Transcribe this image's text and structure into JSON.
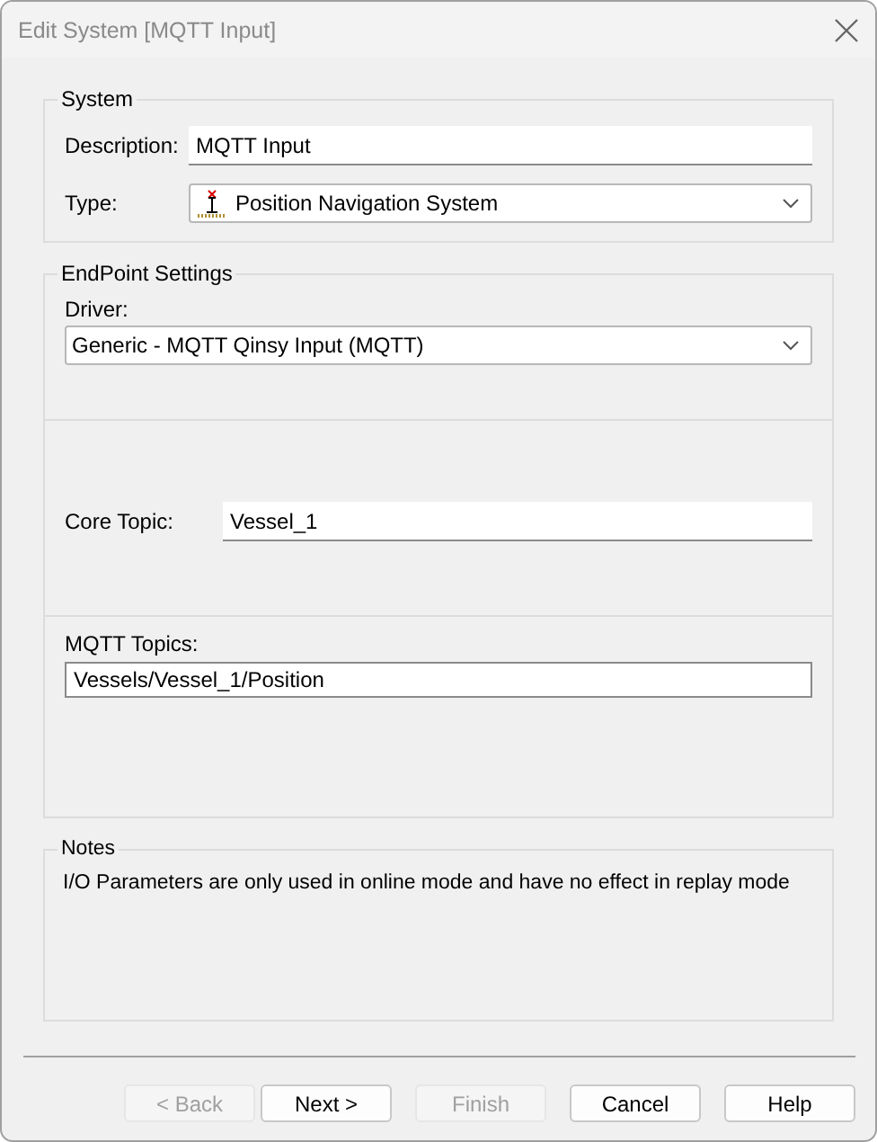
{
  "window": {
    "title": "Edit System [MQTT Input]"
  },
  "system": {
    "title": "System",
    "description": {
      "label": "Description:",
      "value": "MQTT Input"
    },
    "type": {
      "label": "Type:",
      "value": "Position Navigation System"
    }
  },
  "endpoint": {
    "title": "EndPoint Settings",
    "driver": {
      "label": "Driver:",
      "value": "Generic - MQTT Qinsy Input (MQTT)"
    },
    "core_topic": {
      "label": "Core Topic:",
      "value": "Vessel_1"
    },
    "mqtt_topics": {
      "label": "MQTT Topics:",
      "value": "Vessels/Vessel_1/Position"
    }
  },
  "notes": {
    "title": "Notes",
    "text": "I/O Parameters are only used in online mode and have no effect in replay mode"
  },
  "buttons": [
    {
      "label": "< Back",
      "disabled": true
    },
    {
      "label": "Next >",
      "disabled": false
    },
    {
      "label": "Finish",
      "disabled": true
    },
    {
      "label": "Cancel",
      "disabled": false
    },
    {
      "label": "Help",
      "disabled": false
    }
  ]
}
